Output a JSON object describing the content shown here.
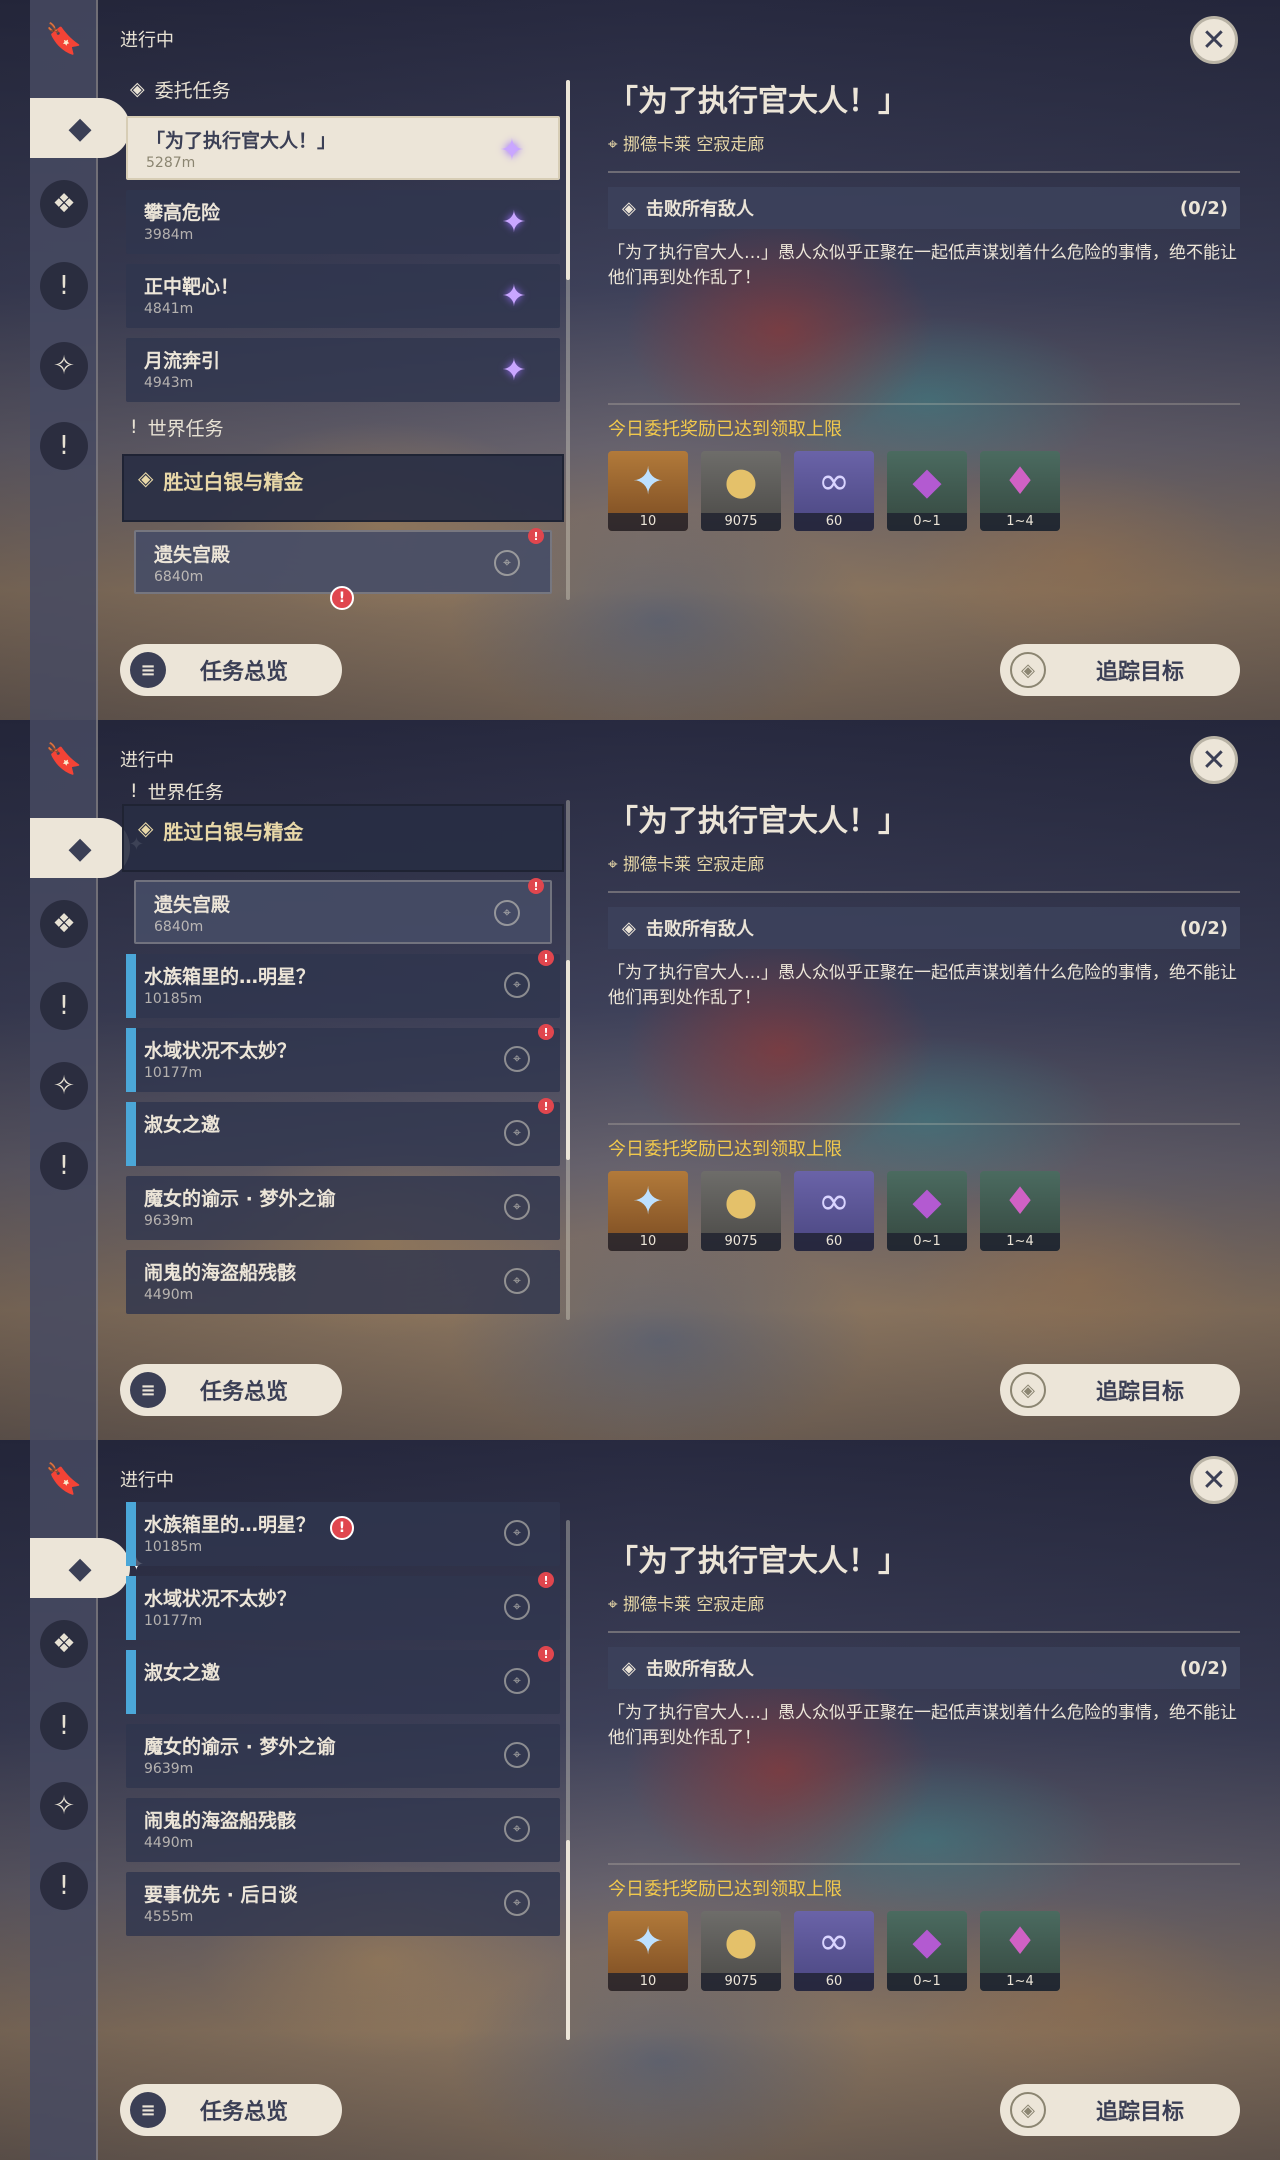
{
  "status": "进行中",
  "close_icon": "close-icon",
  "sections": {
    "commission": "委托任务",
    "world": "世界任务"
  },
  "commissions": [
    {
      "name": "「为了执行官大人！」",
      "dist": "5287m"
    },
    {
      "name": "攀高危险",
      "dist": "3984m"
    },
    {
      "name": "正中靶心！",
      "dist": "4841m"
    },
    {
      "name": "月流奔引",
      "dist": "4943m"
    }
  ],
  "world_group": {
    "title": "胜过白银与精金",
    "sub": {
      "name": "遗失宫殿",
      "dist": "6840m"
    }
  },
  "world_quests": [
    {
      "name": "水族箱里的…明星？",
      "dist": "10185m"
    },
    {
      "name": "水域状况不太妙？",
      "dist": "10177m"
    },
    {
      "name": "淑女之邀",
      "dist": ""
    },
    {
      "name": "魔女的谕示 · 梦外之谕",
      "dist": "9639m"
    },
    {
      "name": "闹鬼的海盗船残骸",
      "dist": "4490m"
    },
    {
      "name": "要事优先 · 后日谈",
      "dist": "4555m"
    }
  ],
  "detail": {
    "title": "「为了执行官大人！」",
    "location": "挪德卡莱 空寂走廊",
    "objective": "击败所有敌人",
    "progress": "(0/2)",
    "description": "「为了执行官大人…」愚人众似乎正聚在一起低声谋划着什么危险的事情，绝不能让他们再到处作乱了！",
    "reward_title": "今日委托奖励已达到领取上限",
    "rewards": [
      {
        "icon": "star-icon",
        "count": "10"
      },
      {
        "icon": "coin-icon",
        "count": "9075"
      },
      {
        "icon": "xp-icon",
        "count": "60"
      },
      {
        "icon": "crystal-icon",
        "count": "0~1"
      },
      {
        "icon": "ore-icon",
        "count": "1~4"
      }
    ]
  },
  "buttons": {
    "overview": "任务总览",
    "track": "追踪目标"
  }
}
